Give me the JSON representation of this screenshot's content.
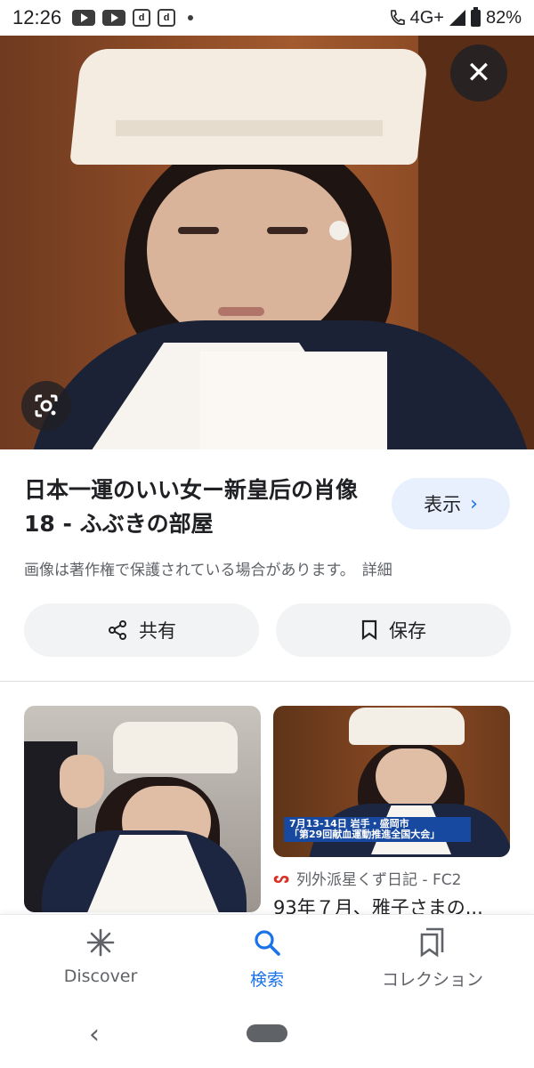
{
  "status_bar": {
    "time": "12:26",
    "network": "4G+",
    "battery": "82%",
    "notif_icons": [
      "youtube-icon",
      "youtube-icon",
      "d-app-icon",
      "d-app-icon",
      "dot-icon"
    ],
    "d_label": "d"
  },
  "viewer": {
    "close_symbol": "✕",
    "title": "日本一運のいい女ー新皇后の肖像 18 - ふぶきの部屋",
    "view_button": "表示",
    "view_chevron": "›",
    "copyright": "画像は著作権で保護されている場合があります。",
    "details_link": "詳細",
    "share_label": "共有",
    "save_label": "保存"
  },
  "related": [
    {
      "caption_line1": "7月13-14日  岩手・盛岡市",
      "caption_line2": "「第29回献血運動推進全国大会」",
      "source": "列外派星くず日記 - FC2",
      "title": "93年７月、雅子さまの..."
    }
  ],
  "bottom_nav": {
    "discover": "Discover",
    "search": "検索",
    "collections": "コレクション"
  },
  "colors": {
    "accent": "#1a73e8",
    "view_button_bg": "#e8f0fe",
    "chip_bg": "#f1f3f4",
    "text_primary": "#202124",
    "text_secondary": "#5f6368"
  }
}
